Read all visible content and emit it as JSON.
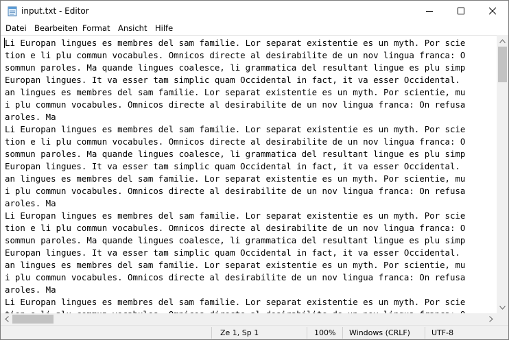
{
  "window": {
    "title": "input.txt - Editor"
  },
  "menu": [
    "Datei",
    "Bearbeiten",
    "Format",
    "Ansicht",
    "Hilfe"
  ],
  "editor": {
    "lines": [
      "Li Europan lingues es membres del sam familie. Lor separat existentie es un myth. Por scie",
      "tion e li plu commun vocabules. Omnicos directe al desirabilite de un nov lingua franca: O",
      "sommun paroles. Ma quande lingues coalesce, li grammatica del resultant lingue es plu simp",
      "Europan lingues. It va esser tam simplic quam Occidental in fact, it va esser Occidental.",
      "an lingues es membres del sam familie. Lor separat existentie es un myth. Por scientie, mu",
      "i plu commun vocabules. Omnicos directe al desirabilite de un nov lingua franca: On refusa",
      "aroles. Ma",
      "Li Europan lingues es membres del sam familie. Lor separat existentie es un myth. Por scie",
      "tion e li plu commun vocabules. Omnicos directe al desirabilite de un nov lingua franca: O",
      "sommun paroles. Ma quande lingues coalesce, li grammatica del resultant lingue es plu simp",
      "Europan lingues. It va esser tam simplic quam Occidental in fact, it va esser Occidental.",
      "an lingues es membres del sam familie. Lor separat existentie es un myth. Por scientie, mu",
      "i plu commun vocabules. Omnicos directe al desirabilite de un nov lingua franca: On refusa",
      "aroles. Ma",
      "Li Europan lingues es membres del sam familie. Lor separat existentie es un myth. Por scie",
      "tion e li plu commun vocabules. Omnicos directe al desirabilite de un nov lingua franca: O",
      "sommun paroles. Ma quande lingues coalesce, li grammatica del resultant lingue es plu simp",
      "Europan lingues. It va esser tam simplic quam Occidental in fact, it va esser Occidental.",
      "an lingues es membres del sam familie. Lor separat existentie es un myth. Por scientie, mu",
      "i plu commun vocabules. Omnicos directe al desirabilite de un nov lingua franca: On refusa",
      "aroles. Ma",
      "Li Europan lingues es membres del sam familie. Lor separat existentie es un myth. Por scie",
      "tion e li plu commun vocabules. Omnicos directe al desirabilite de un nov lingua franca: O"
    ]
  },
  "status": {
    "position": "Ze 1, Sp 1",
    "zoom": "100%",
    "line_ending": "Windows (CRLF)",
    "encoding": "UTF-8"
  }
}
